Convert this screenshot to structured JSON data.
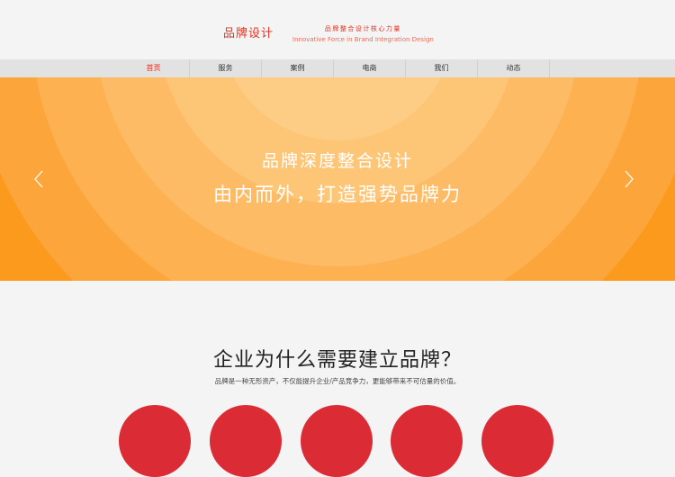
{
  "header": {
    "logo": "品牌设计",
    "tagline_cn": "品牌整合设计核心力量",
    "tagline_en": "Innovative Force in Brand Integration Design"
  },
  "nav": {
    "items": [
      "首页",
      "服务",
      "案例",
      "电商",
      "我们",
      "动态"
    ],
    "active_index": 0
  },
  "hero": {
    "line1": "品牌深度整合设计",
    "line2": "由内而外，打造强势品牌力",
    "prev_icon": "chevron-left-icon",
    "next_icon": "chevron-right-icon"
  },
  "section": {
    "title": "企业为什么需要建立品牌？",
    "subtitle": "品牌是一种无形资产，不仅能提升企业/产品竞争力，更能够带来不可估量的价值。"
  },
  "colors": {
    "accent": "#e0301e",
    "hero_orange": "#fb9a1d",
    "circle_red": "#db2b35"
  }
}
